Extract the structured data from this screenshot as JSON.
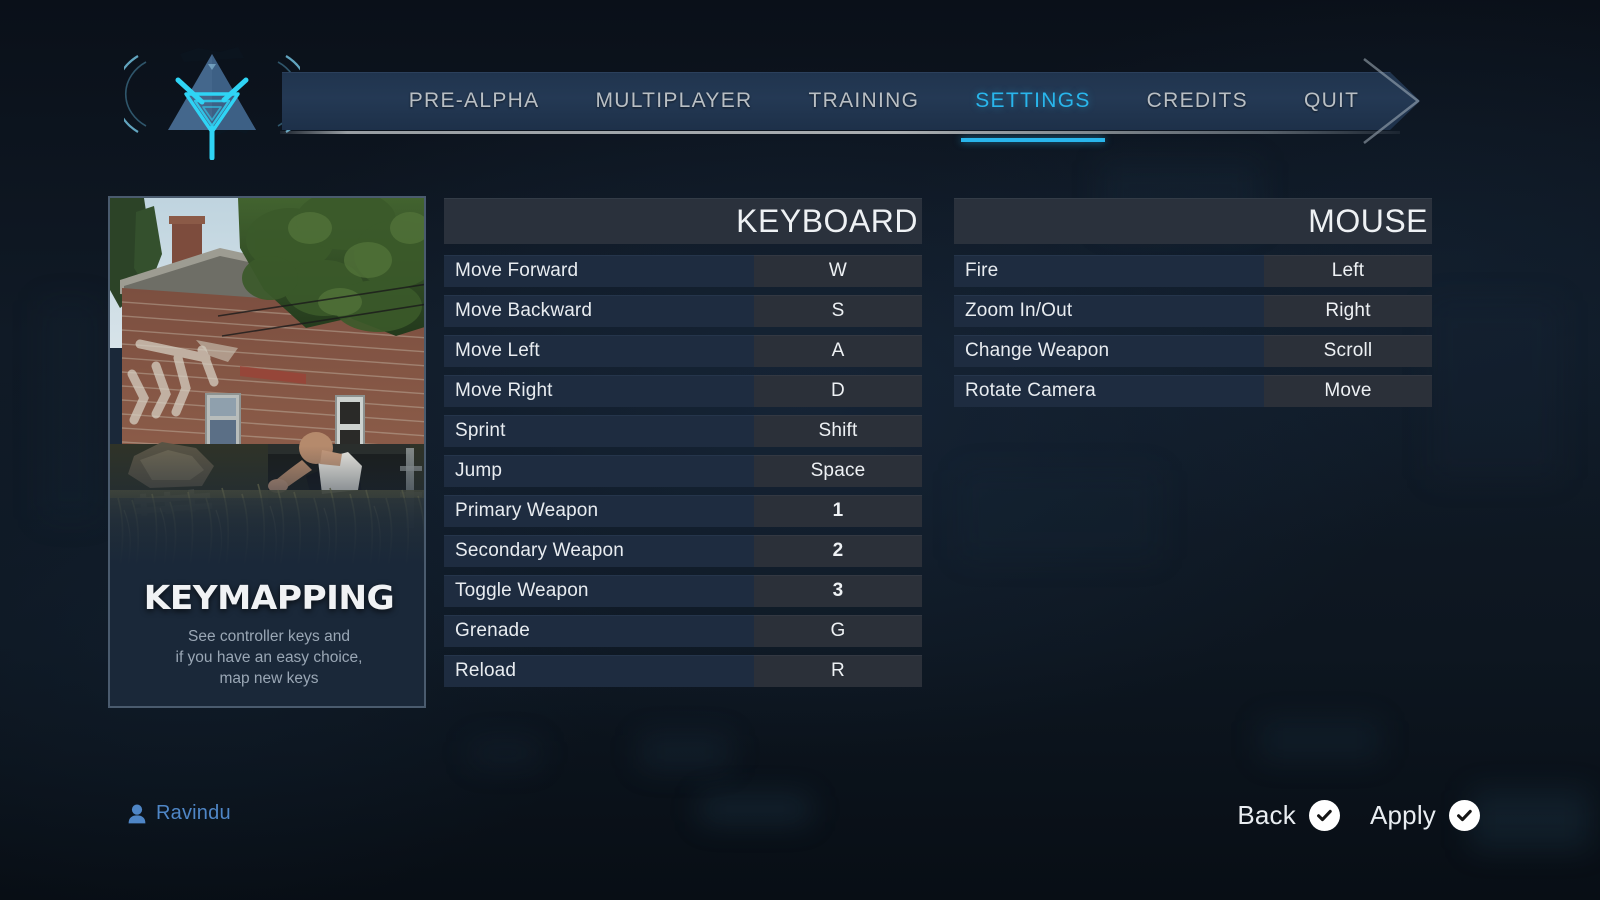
{
  "nav": {
    "items": [
      {
        "label": "PRE-ALPHA",
        "active": false
      },
      {
        "label": "MULTIPLAYER",
        "active": false
      },
      {
        "label": "TRAINING",
        "active": false
      },
      {
        "label": "SETTINGS",
        "active": true
      },
      {
        "label": "CREDITS",
        "active": false
      },
      {
        "label": "QUIT",
        "active": false
      }
    ],
    "logo_icon": "triangle-prism-logo-icon"
  },
  "promo": {
    "title": "KEYMAPPING",
    "description": "See controller keys and\nif you have an easy choice,\nmap new keys",
    "image_alt": "gameplay-screenshot-character-behind-dumpster"
  },
  "keyboard": {
    "header": "KEYBOARD",
    "rows": [
      {
        "action": "Move Forward",
        "key": "W",
        "numeric": false
      },
      {
        "action": "Move Backward",
        "key": "S",
        "numeric": false
      },
      {
        "action": "Move Left",
        "key": "A",
        "numeric": false
      },
      {
        "action": "Move Right",
        "key": "D",
        "numeric": false
      },
      {
        "action": "Sprint",
        "key": "Shift",
        "numeric": false
      },
      {
        "action": "Jump",
        "key": "Space",
        "numeric": false
      },
      {
        "action": "Primary Weapon",
        "key": "1",
        "numeric": true
      },
      {
        "action": "Secondary Weapon",
        "key": "2",
        "numeric": true
      },
      {
        "action": "Toggle Weapon",
        "key": "3",
        "numeric": true
      },
      {
        "action": "Grenade",
        "key": "G",
        "numeric": false
      },
      {
        "action": "Reload",
        "key": "R",
        "numeric": false
      }
    ]
  },
  "mouse": {
    "header": "MOUSE",
    "rows": [
      {
        "action": "Fire",
        "key": "Left",
        "numeric": false
      },
      {
        "action": "Zoom In/Out",
        "key": "Right",
        "numeric": false
      },
      {
        "action": "Change Weapon",
        "key": "Scroll",
        "numeric": false
      },
      {
        "action": "Rotate Camera",
        "key": "Move",
        "numeric": false
      }
    ]
  },
  "footer": {
    "user_name": "Ravindu",
    "user_icon": "person-icon",
    "back_label": "Back",
    "apply_label": "Apply",
    "back_icon": "check-circle-icon",
    "apply_icon": "check-circle-icon"
  },
  "colors": {
    "accent": "#29b6ec",
    "page_bg": "#0c141e",
    "nav_bar": "#243954",
    "table_header_bg": "#2a313c",
    "row_label_bg": "#1e2c40",
    "row_value_bg": "#2b3039",
    "user_text": "#4f86c6"
  }
}
